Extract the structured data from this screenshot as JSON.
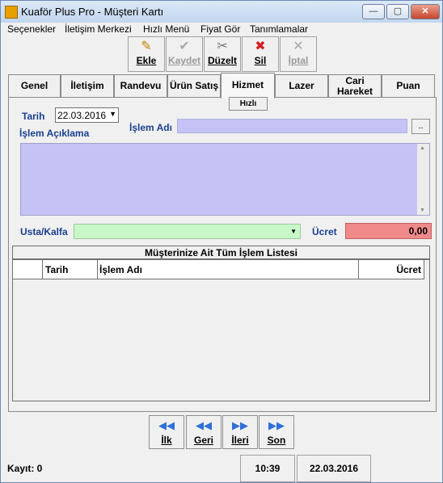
{
  "window": {
    "title": "Kuaför Plus Pro - Müşteri Kartı"
  },
  "menu": {
    "items": [
      "Seçenekler",
      "İletişim Merkezi",
      "Hızlı Menü",
      "Fiyat Gör",
      "Tanımlamalar"
    ]
  },
  "toolbar": {
    "ekle": "Ekle",
    "kaydet": "Kaydet",
    "duzelt": "Düzelt",
    "sil": "Sil",
    "iptal": "İptal"
  },
  "tabs": [
    "Genel",
    "İletişim",
    "Randevu",
    "Ürün Satış",
    "Hizmet",
    "Lazer",
    "Cari Hareket",
    "Puan"
  ],
  "form": {
    "hizli": "Hızlı",
    "tarih_label": "Tarih",
    "tarih_value": "22.03.2016",
    "islem_adi_label": "İşlem Adı",
    "browse": "..",
    "islem_aciklama_label": "İşlem Açıklama",
    "usta_label": "Usta/Kalfa",
    "ucret_label": "Ücret",
    "ucret_value": "0,00"
  },
  "grid": {
    "title": "Müşterinize Ait Tüm İşlem Listesi",
    "columns": [
      "Tarih",
      "İşlem Adı",
      "Ücret"
    ]
  },
  "nav": {
    "ilk": "İlk",
    "geri": "Geri",
    "ileri": "İleri",
    "son": "Son"
  },
  "status": {
    "kayit": "Kayıt: 0",
    "time": "10:39",
    "date": "22.03.2016"
  },
  "colors": {
    "input_purple": "#c5c3f5",
    "input_green": "#c8f8c8",
    "input_red": "#f08a8a",
    "label_blue": "#1a3f8f"
  }
}
